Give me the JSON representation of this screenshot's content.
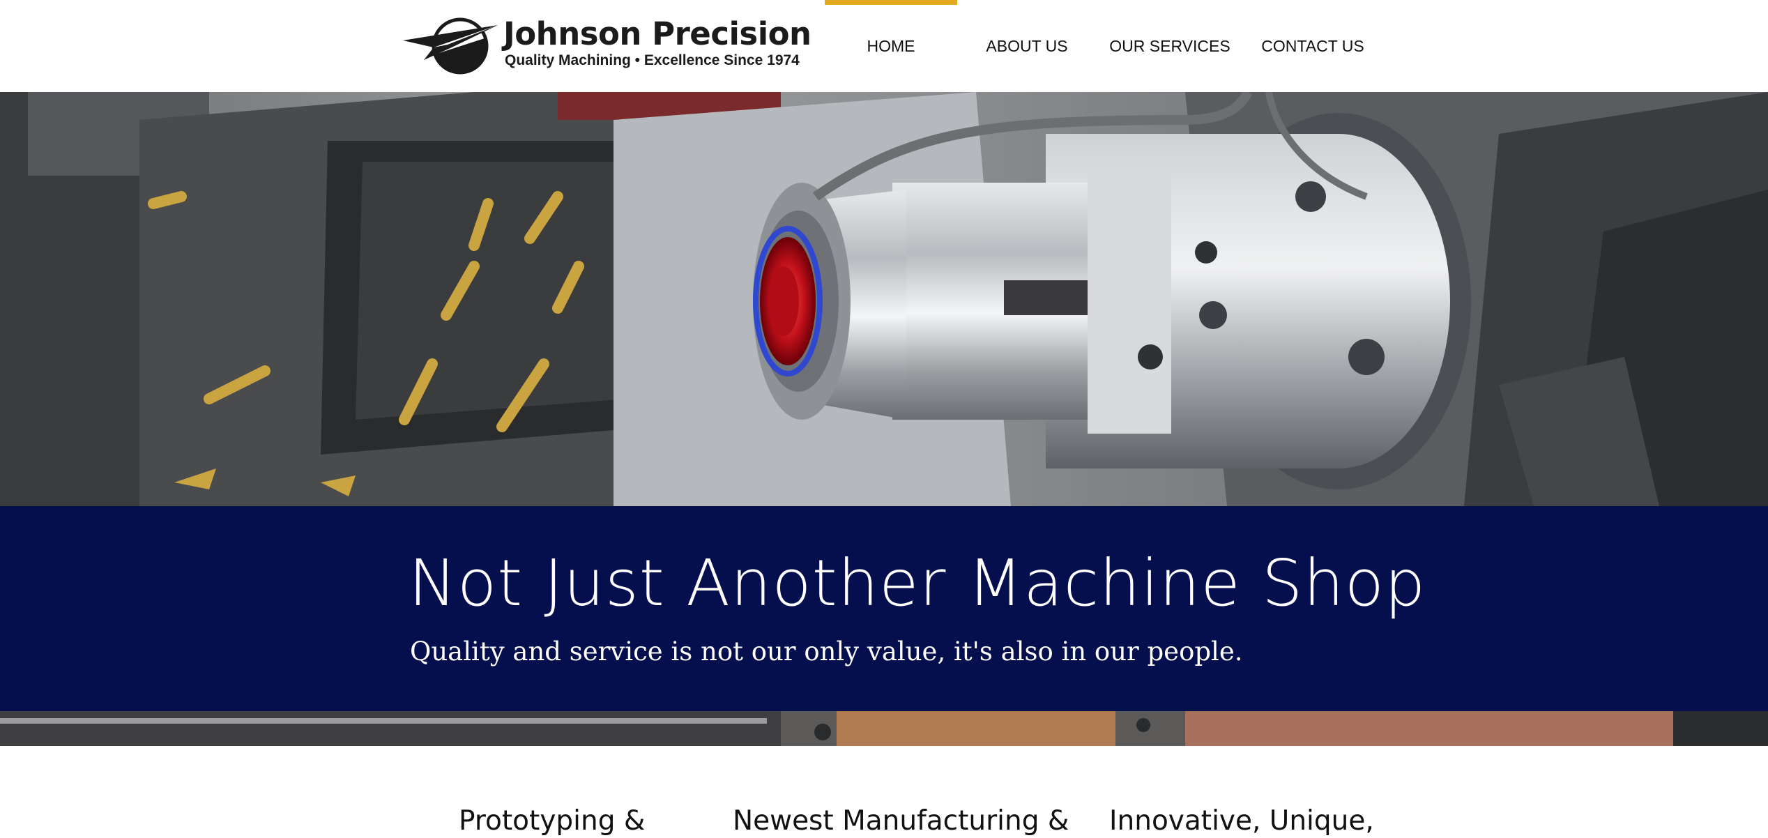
{
  "header": {
    "logo": {
      "title": "Johnson Precision",
      "tagline": "Quality Machining • Excellence Since 1974"
    },
    "nav": [
      {
        "label": "HOME",
        "active": true
      },
      {
        "label": "ABOUT US",
        "active": false
      },
      {
        "label": "OUR SERVICES",
        "active": false
      },
      {
        "label": "CONTACT US",
        "active": false
      }
    ],
    "accent_color": "#e4aa22"
  },
  "hero": {
    "image": "cnc-lathe-chuck-photo"
  },
  "banner": {
    "title": "Not Just Another Machine Shop",
    "subtitle": "Quality and service is not our only value, it's also in our people.",
    "background_color": "#050f4e"
  },
  "features": [
    {
      "title": "Prototyping &"
    },
    {
      "title": "Newest Manufacturing &"
    },
    {
      "title": "Innovative, Unique,"
    }
  ]
}
